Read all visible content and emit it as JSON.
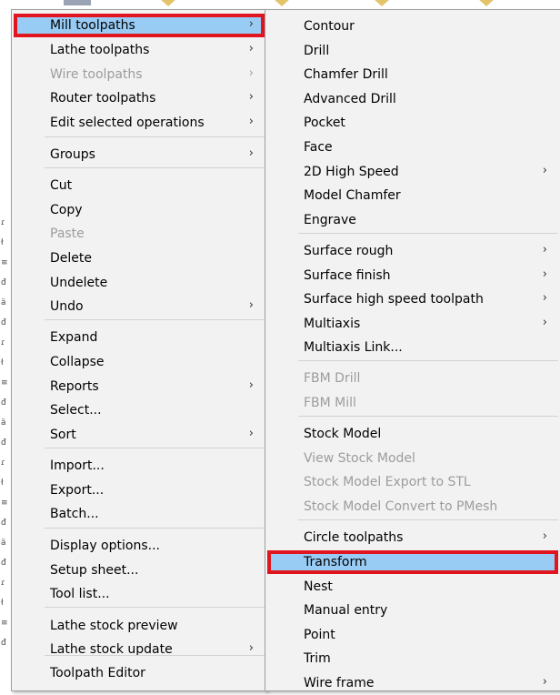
{
  "colors": {
    "menu_bg": "#f2f2f2",
    "highlight": "#99ccf5",
    "callout_red": "#e0151f",
    "disabled_text": "#9c9c9c"
  },
  "main_menu": {
    "items": [
      {
        "label": "Mill toolpaths",
        "submenu": true,
        "highlighted": true,
        "annotated": true
      },
      {
        "label": "Lathe toolpaths",
        "submenu": true
      },
      {
        "label": "Wire toolpaths",
        "submenu": true,
        "disabled": true
      },
      {
        "label": "Router toolpaths",
        "submenu": true
      },
      {
        "label": "Edit selected operations",
        "submenu": true
      },
      {
        "label": "Groups",
        "submenu": true
      },
      {
        "label": "Cut"
      },
      {
        "label": "Copy"
      },
      {
        "label": "Paste",
        "disabled": true
      },
      {
        "label": "Delete"
      },
      {
        "label": "Undelete"
      },
      {
        "label": "Undo",
        "submenu": true
      },
      {
        "label": "Expand"
      },
      {
        "label": "Collapse"
      },
      {
        "label": "Reports",
        "submenu": true
      },
      {
        "label": "Select..."
      },
      {
        "label": "Sort",
        "submenu": true
      },
      {
        "label": "Import..."
      },
      {
        "label": "Export..."
      },
      {
        "label": "Batch..."
      },
      {
        "label": "Display options..."
      },
      {
        "label": "Setup sheet..."
      },
      {
        "label": "Tool list..."
      },
      {
        "label": "Lathe stock preview"
      },
      {
        "label": "Lathe stock update",
        "submenu": true
      },
      {
        "label": "Toolpath Editor"
      }
    ]
  },
  "sub_menu": {
    "items": [
      {
        "label": "Contour"
      },
      {
        "label": "Drill"
      },
      {
        "label": "Chamfer Drill"
      },
      {
        "label": "Advanced Drill"
      },
      {
        "label": "Pocket"
      },
      {
        "label": "Face"
      },
      {
        "label": "2D High Speed",
        "submenu": true
      },
      {
        "label": "Model Chamfer"
      },
      {
        "label": "Engrave"
      },
      {
        "label": "Surface rough",
        "submenu": true
      },
      {
        "label": "Surface finish",
        "submenu": true
      },
      {
        "label": "Surface high speed toolpath",
        "submenu": true
      },
      {
        "label": "Multiaxis",
        "submenu": true
      },
      {
        "label": "Multiaxis Link..."
      },
      {
        "label": "FBM Drill",
        "disabled": true
      },
      {
        "label": "FBM Mill",
        "disabled": true
      },
      {
        "label": "Stock Model"
      },
      {
        "label": "View Stock Model",
        "disabled": true
      },
      {
        "label": "Stock Model Export to STL",
        "disabled": true
      },
      {
        "label": "Stock Model Convert to PMesh",
        "disabled": true
      },
      {
        "label": "Circle toolpaths",
        "submenu": true
      },
      {
        "label": "Transform",
        "highlighted": true,
        "annotated": true
      },
      {
        "label": "Nest"
      },
      {
        "label": "Manual entry"
      },
      {
        "label": "Point"
      },
      {
        "label": "Trim"
      },
      {
        "label": "Wire frame",
        "submenu": true
      }
    ]
  },
  "icons": {
    "submenu_arrow": "chevron-right-icon"
  }
}
